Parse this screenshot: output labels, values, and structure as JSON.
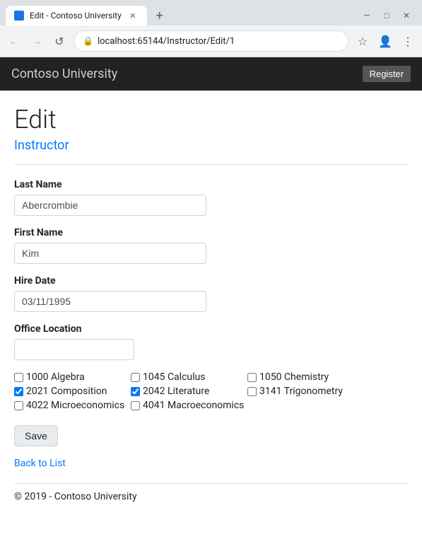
{
  "browser": {
    "tab_title": "Edit - Contoso University",
    "url": "localhost:65144/Instructor/Edit/1",
    "new_tab_label": "+",
    "close_label": "✕",
    "back_label": "←",
    "forward_label": "→",
    "reload_label": "↺",
    "minimize_label": "—",
    "maximize_label": "□",
    "window_close_label": "✕",
    "star_label": "☆",
    "profile_label": "👤",
    "menu_label": "⋮",
    "lock_label": "🔒"
  },
  "header": {
    "title": "Contoso University",
    "button_label": "Register"
  },
  "page": {
    "heading": "Edit",
    "subheading": "Instructor"
  },
  "form": {
    "last_name_label": "Last Name",
    "last_name_value": "Abercrombie",
    "first_name_label": "First Name",
    "first_name_value": "Kim",
    "hire_date_label": "Hire Date",
    "hire_date_value": "03/11/1995",
    "office_location_label": "Office Location",
    "office_location_value": ""
  },
  "courses": [
    {
      "id": "1000",
      "name": "Algebra",
      "checked": false
    },
    {
      "id": "1045",
      "name": "Calculus",
      "checked": false
    },
    {
      "id": "1050",
      "name": "Chemistry",
      "checked": false
    },
    {
      "id": "2021",
      "name": "Composition",
      "checked": true
    },
    {
      "id": "2042",
      "name": "Literature",
      "checked": true
    },
    {
      "id": "3141",
      "name": "Trigonometry",
      "checked": false
    },
    {
      "id": "4022",
      "name": "Microeconomics",
      "checked": false
    },
    {
      "id": "4041",
      "name": "Macroeconomics",
      "checked": false
    }
  ],
  "buttons": {
    "save_label": "Save"
  },
  "links": {
    "back_to_list_label": "Back to List"
  },
  "footer": {
    "copyright": "© 2019 - Contoso University"
  }
}
